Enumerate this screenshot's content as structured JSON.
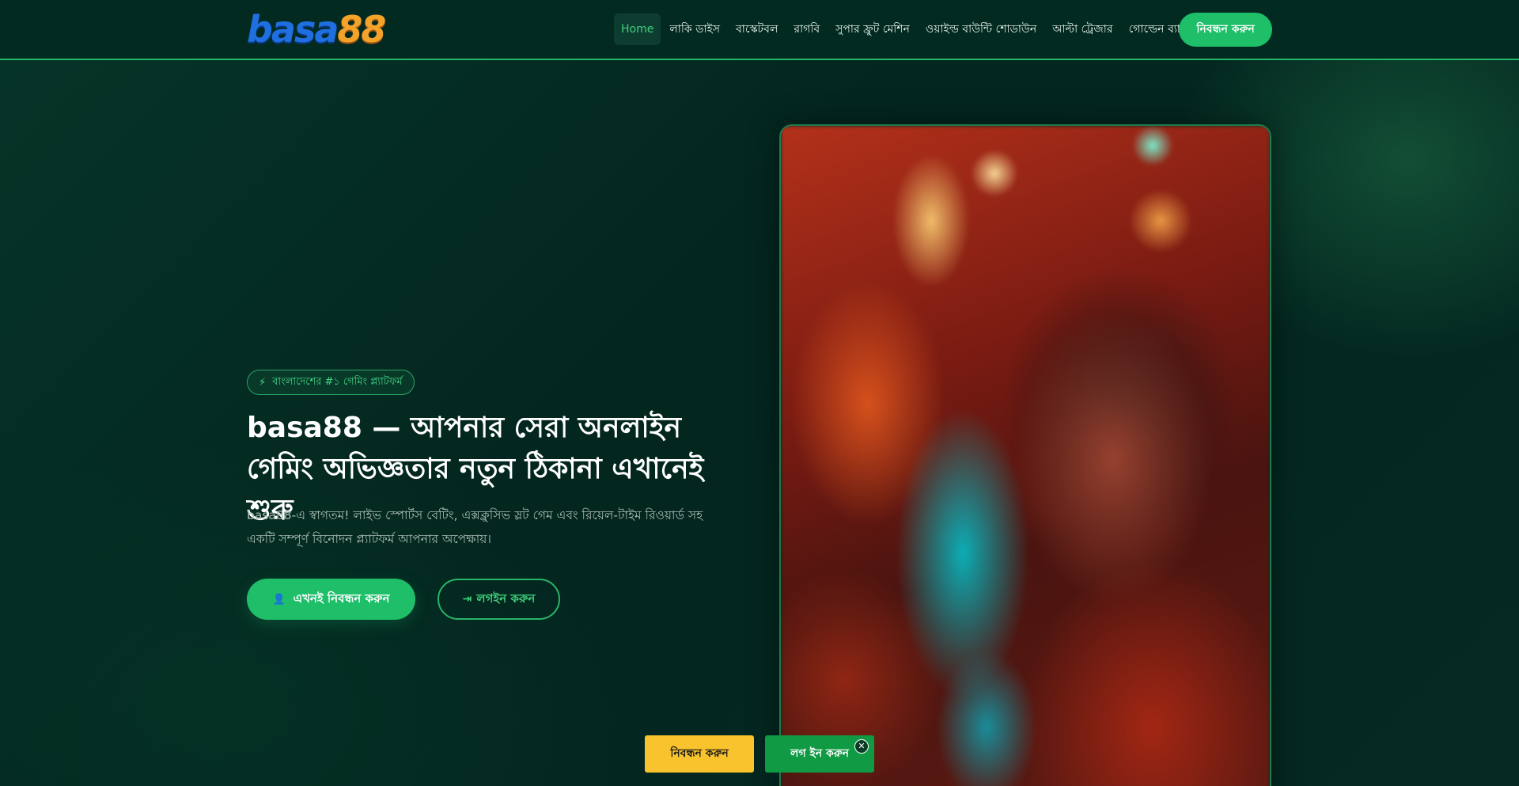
{
  "header": {
    "logo": {
      "part1": "basa",
      "part2": "88"
    },
    "nav": [
      {
        "label": "Home",
        "active": true
      },
      {
        "label": "লাকি ডাইস"
      },
      {
        "label": "বাস্কেটবল"
      },
      {
        "label": "রাগবি"
      },
      {
        "label": "সুপার ফ্রুট মেশিন"
      },
      {
        "label": "ওয়াইল্ড বাউন্টি শোডাউন"
      },
      {
        "label": "আল্টা ট্রেজার"
      },
      {
        "label": "গোল্ডেন ব্যাংক"
      }
    ],
    "cta_label": "নিবন্ধন করুন"
  },
  "hero": {
    "badge_icon": "bolt-icon",
    "badge_label": "বাংলাদেশের #১ গেমিং প্ল্যাটফর্ম",
    "title": "basa88 — আপনার সেরা অনলাইন গেমিং অভিজ্ঞতার নতুন ঠিকানা এখানেই শুরু",
    "description": "basa88-এ স্বাগতম! লাইভ স্পোর্টস বেটিং, এক্সক্লুসিভ স্লট গেম এবং রিয়েল-টাইম রিওয়ার্ড সহ একটি সম্পূর্ণ বিনোদন প্ল্যাটফর্ম আপনার অপেক্ষায়।",
    "primary_button": "এখনই নিবন্ধন করুন",
    "secondary_button": "লগইন করুন"
  },
  "floating_bar": {
    "register_label": "নিবন্ধন করুন",
    "login_label": "লগ ইন করুন",
    "close_glyph": "✕"
  },
  "colors": {
    "background": "#032a22",
    "accent_green": "#1fbf6a",
    "accent_yellow": "#f8c32c",
    "login_green": "#0f9a43"
  }
}
